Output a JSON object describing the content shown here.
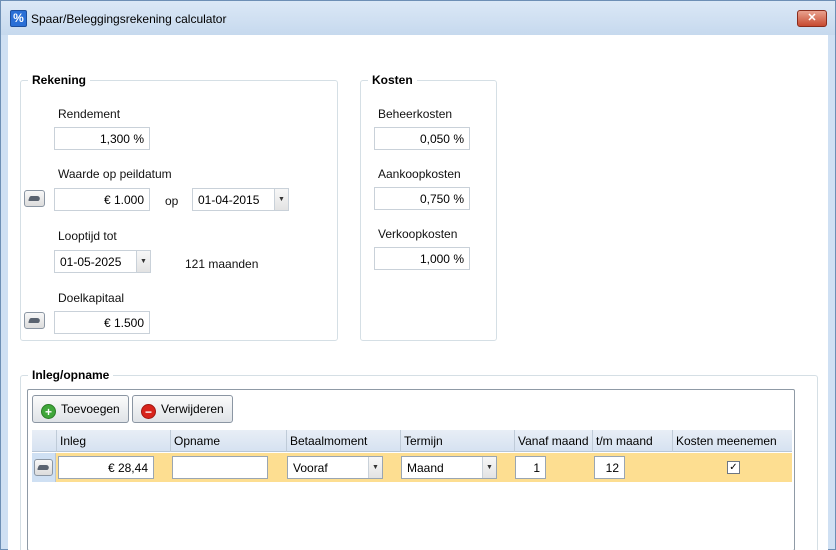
{
  "window": {
    "title": "Spaar/Beleggingsrekening calculator",
    "close_label": "✕",
    "app_icon_glyph": "%"
  },
  "rekening": {
    "title": "Rekening",
    "rendement_label": "Rendement",
    "rendement_value": "1,300 %",
    "waarde_label": "Waarde op peildatum",
    "waarde_value": "€ 1.000",
    "op_label": "op",
    "peildatum_value": "01-04-2015",
    "looptijd_label": "Looptijd tot",
    "looptijd_value": "01-05-2025",
    "maanden_text": "121 maanden",
    "doelkapitaal_label": "Doelkapitaal",
    "doelkapitaal_value": "€ 1.500"
  },
  "kosten": {
    "title": "Kosten",
    "beheer_label": "Beheerkosten",
    "beheer_value": "0,050 %",
    "aankoop_label": "Aankoopkosten",
    "aankoop_value": "0,750 %",
    "verkoop_label": "Verkoopkosten",
    "verkoop_value": "1,000 %"
  },
  "inleg": {
    "title": "Inleg/opname",
    "add_label": "Toevoegen",
    "remove_label": "Verwijderen",
    "columns": [
      "Inleg",
      "Opname",
      "Betaalmoment",
      "Termijn",
      "Vanaf maand",
      "t/m maand",
      "Kosten meenemen"
    ],
    "row": {
      "inleg": "€ 28,44",
      "opname": "",
      "betaalmoment": "Vooraf",
      "termijn": "Maand",
      "vanaf": "1",
      "tm": "12",
      "kosten_meenemen": "✓"
    }
  },
  "colors": {
    "selected_row": "#fdde91",
    "header": "#d6e2f1",
    "window_frame": "#cfe0f3"
  }
}
